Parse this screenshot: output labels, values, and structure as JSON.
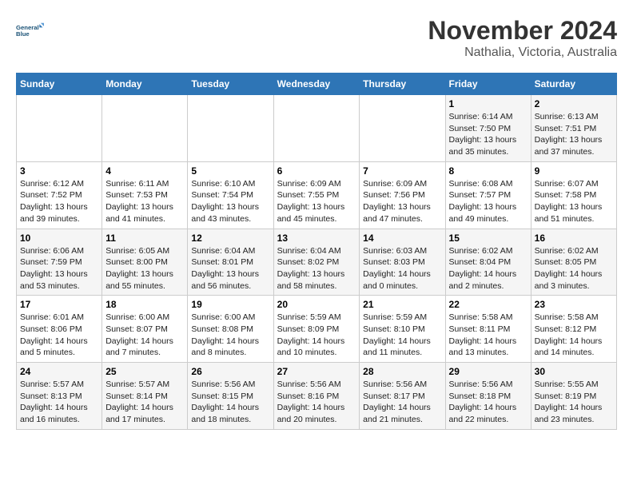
{
  "header": {
    "logo_line1": "General",
    "logo_line2": "Blue",
    "title": "November 2024",
    "subtitle": "Nathalia, Victoria, Australia"
  },
  "weekdays": [
    "Sunday",
    "Monday",
    "Tuesday",
    "Wednesday",
    "Thursday",
    "Friday",
    "Saturday"
  ],
  "weeks": [
    [
      {
        "day": "",
        "detail": ""
      },
      {
        "day": "",
        "detail": ""
      },
      {
        "day": "",
        "detail": ""
      },
      {
        "day": "",
        "detail": ""
      },
      {
        "day": "",
        "detail": ""
      },
      {
        "day": "1",
        "detail": "Sunrise: 6:14 AM\nSunset: 7:50 PM\nDaylight: 13 hours and 35 minutes."
      },
      {
        "day": "2",
        "detail": "Sunrise: 6:13 AM\nSunset: 7:51 PM\nDaylight: 13 hours and 37 minutes."
      }
    ],
    [
      {
        "day": "3",
        "detail": "Sunrise: 6:12 AM\nSunset: 7:52 PM\nDaylight: 13 hours and 39 minutes."
      },
      {
        "day": "4",
        "detail": "Sunrise: 6:11 AM\nSunset: 7:53 PM\nDaylight: 13 hours and 41 minutes."
      },
      {
        "day": "5",
        "detail": "Sunrise: 6:10 AM\nSunset: 7:54 PM\nDaylight: 13 hours and 43 minutes."
      },
      {
        "day": "6",
        "detail": "Sunrise: 6:09 AM\nSunset: 7:55 PM\nDaylight: 13 hours and 45 minutes."
      },
      {
        "day": "7",
        "detail": "Sunrise: 6:09 AM\nSunset: 7:56 PM\nDaylight: 13 hours and 47 minutes."
      },
      {
        "day": "8",
        "detail": "Sunrise: 6:08 AM\nSunset: 7:57 PM\nDaylight: 13 hours and 49 minutes."
      },
      {
        "day": "9",
        "detail": "Sunrise: 6:07 AM\nSunset: 7:58 PM\nDaylight: 13 hours and 51 minutes."
      }
    ],
    [
      {
        "day": "10",
        "detail": "Sunrise: 6:06 AM\nSunset: 7:59 PM\nDaylight: 13 hours and 53 minutes."
      },
      {
        "day": "11",
        "detail": "Sunrise: 6:05 AM\nSunset: 8:00 PM\nDaylight: 13 hours and 55 minutes."
      },
      {
        "day": "12",
        "detail": "Sunrise: 6:04 AM\nSunset: 8:01 PM\nDaylight: 13 hours and 56 minutes."
      },
      {
        "day": "13",
        "detail": "Sunrise: 6:04 AM\nSunset: 8:02 PM\nDaylight: 13 hours and 58 minutes."
      },
      {
        "day": "14",
        "detail": "Sunrise: 6:03 AM\nSunset: 8:03 PM\nDaylight: 14 hours and 0 minutes."
      },
      {
        "day": "15",
        "detail": "Sunrise: 6:02 AM\nSunset: 8:04 PM\nDaylight: 14 hours and 2 minutes."
      },
      {
        "day": "16",
        "detail": "Sunrise: 6:02 AM\nSunset: 8:05 PM\nDaylight: 14 hours and 3 minutes."
      }
    ],
    [
      {
        "day": "17",
        "detail": "Sunrise: 6:01 AM\nSunset: 8:06 PM\nDaylight: 14 hours and 5 minutes."
      },
      {
        "day": "18",
        "detail": "Sunrise: 6:00 AM\nSunset: 8:07 PM\nDaylight: 14 hours and 7 minutes."
      },
      {
        "day": "19",
        "detail": "Sunrise: 6:00 AM\nSunset: 8:08 PM\nDaylight: 14 hours and 8 minutes."
      },
      {
        "day": "20",
        "detail": "Sunrise: 5:59 AM\nSunset: 8:09 PM\nDaylight: 14 hours and 10 minutes."
      },
      {
        "day": "21",
        "detail": "Sunrise: 5:59 AM\nSunset: 8:10 PM\nDaylight: 14 hours and 11 minutes."
      },
      {
        "day": "22",
        "detail": "Sunrise: 5:58 AM\nSunset: 8:11 PM\nDaylight: 14 hours and 13 minutes."
      },
      {
        "day": "23",
        "detail": "Sunrise: 5:58 AM\nSunset: 8:12 PM\nDaylight: 14 hours and 14 minutes."
      }
    ],
    [
      {
        "day": "24",
        "detail": "Sunrise: 5:57 AM\nSunset: 8:13 PM\nDaylight: 14 hours and 16 minutes."
      },
      {
        "day": "25",
        "detail": "Sunrise: 5:57 AM\nSunset: 8:14 PM\nDaylight: 14 hours and 17 minutes."
      },
      {
        "day": "26",
        "detail": "Sunrise: 5:56 AM\nSunset: 8:15 PM\nDaylight: 14 hours and 18 minutes."
      },
      {
        "day": "27",
        "detail": "Sunrise: 5:56 AM\nSunset: 8:16 PM\nDaylight: 14 hours and 20 minutes."
      },
      {
        "day": "28",
        "detail": "Sunrise: 5:56 AM\nSunset: 8:17 PM\nDaylight: 14 hours and 21 minutes."
      },
      {
        "day": "29",
        "detail": "Sunrise: 5:56 AM\nSunset: 8:18 PM\nDaylight: 14 hours and 22 minutes."
      },
      {
        "day": "30",
        "detail": "Sunrise: 5:55 AM\nSunset: 8:19 PM\nDaylight: 14 hours and 23 minutes."
      }
    ]
  ]
}
